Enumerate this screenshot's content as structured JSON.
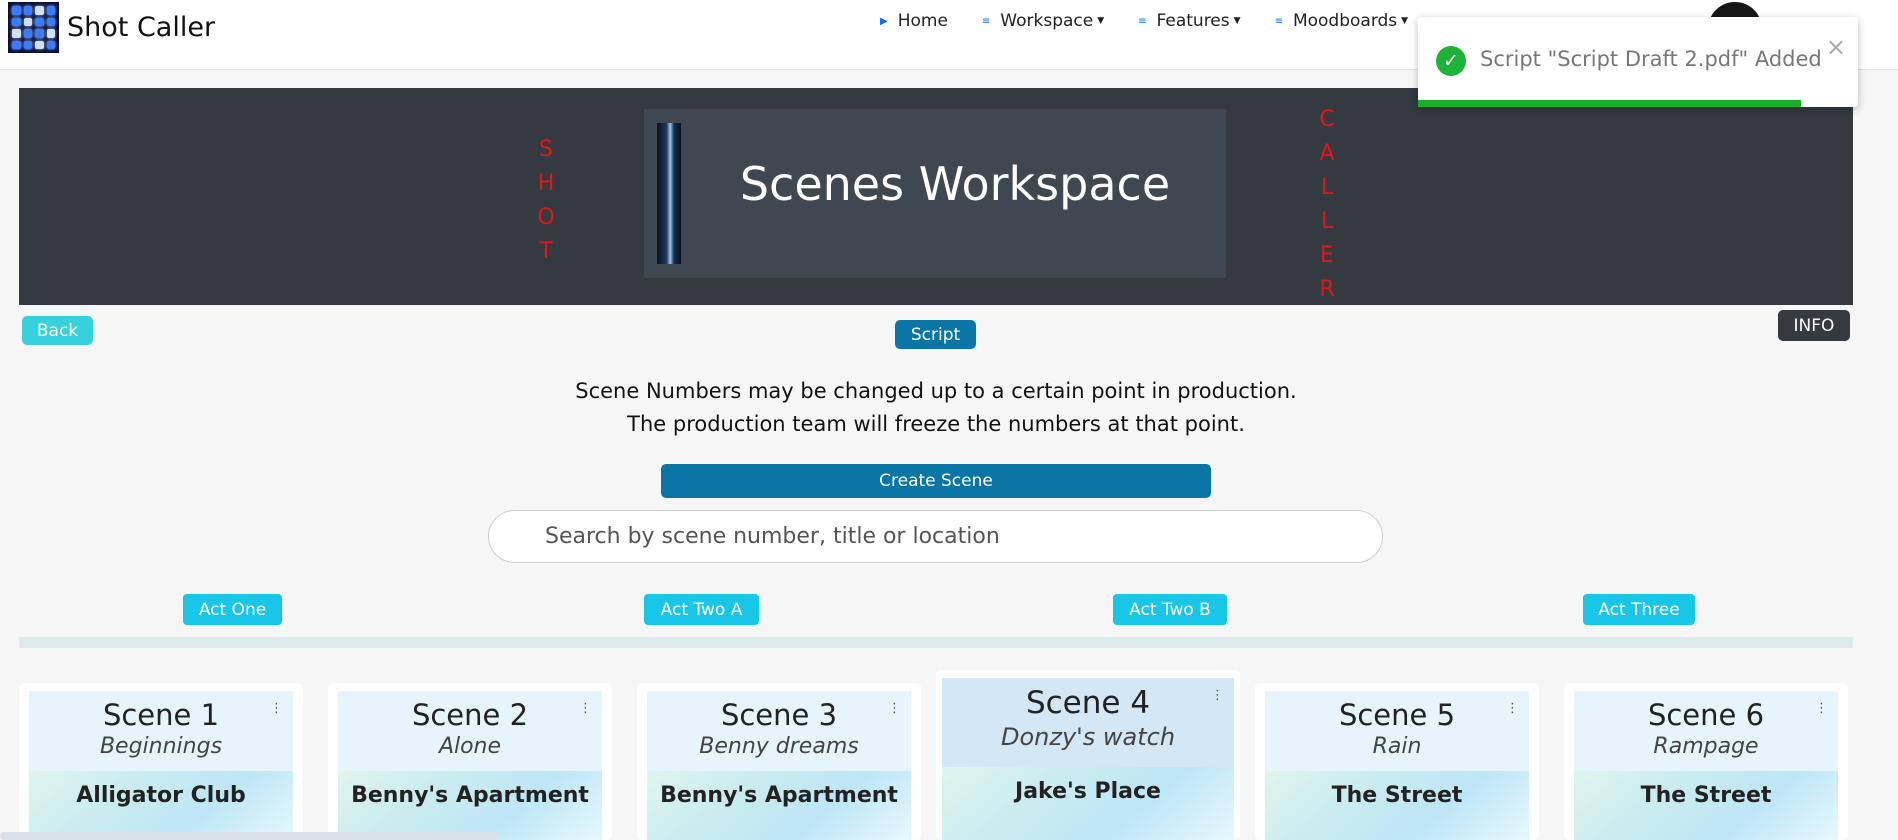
{
  "app": {
    "name": "Shot Caller"
  },
  "nav": {
    "home": "Home",
    "workspace": "Workspace",
    "features": "Features",
    "moodboards": "Moodboards"
  },
  "hero": {
    "left_vertical": "SHOT",
    "right_vertical": "CALLER",
    "title": "Scenes Workspace"
  },
  "buttons": {
    "back": "Back",
    "script": "Script",
    "info": "INFO",
    "create_scene": "Create Scene"
  },
  "message": {
    "line1": "Scene Numbers may be changed up to a certain point in production.",
    "line2": "The production team will freeze the numbers at that point."
  },
  "search": {
    "placeholder": "Search by scene number, title or location"
  },
  "acts": [
    "Act One",
    "Act Two A",
    "Act Two B",
    "Act Three"
  ],
  "scenes": [
    {
      "number": "Scene 1",
      "title": "Beginnings",
      "location": "Alligator Club"
    },
    {
      "number": "Scene 2",
      "title": "Alone",
      "location": "Benny's Apartment"
    },
    {
      "number": "Scene 3",
      "title": "Benny dreams",
      "location": "Benny's Apartment"
    },
    {
      "number": "Scene 4",
      "title": "Donzy's watch",
      "location": "Jake's Place"
    },
    {
      "number": "Scene 5",
      "title": "Rain",
      "location": "The Street"
    },
    {
      "number": "Scene 6",
      "title": "Rampage",
      "location": "The Street"
    }
  ],
  "toast": {
    "message": "Script \"Script Draft 2.pdf\" Added",
    "progress": 0.87,
    "close_symbol": "×"
  },
  "colors": {
    "accent": "#0b76a6",
    "cyan": "#18c6e8",
    "hero_bg": "#343a40",
    "vertical_text": "#e0161a",
    "success": "#1db33a"
  }
}
